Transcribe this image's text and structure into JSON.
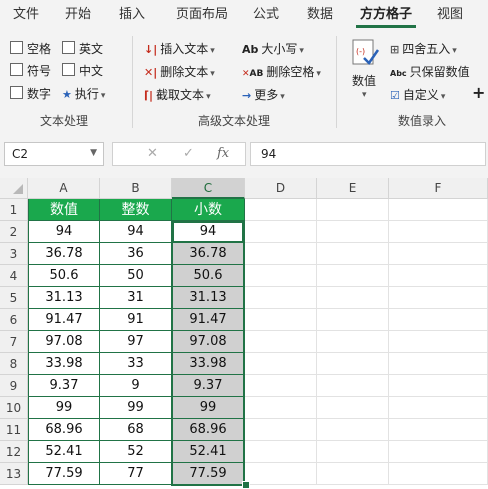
{
  "tabs": [
    "文件",
    "开始",
    "插入",
    "页面布局",
    "公式",
    "数据",
    "方方格子",
    "视图"
  ],
  "active_tab": "方方格子",
  "ribbon": {
    "text_checks": [
      "空格",
      "英文",
      "符号",
      "中文",
      "数字"
    ],
    "exec_label": "执行",
    "text_group_label": "文本处理",
    "adv_buttons": [
      "插入文本",
      "删除文本",
      "截取文本",
      "大小写",
      "删除空格",
      "更多"
    ],
    "adv_group_label": "高级文本处理",
    "numeric_button": "数值",
    "num_buttons": [
      "四舍五入",
      "只保留数值",
      "自定义"
    ],
    "num_group_label": "数值录入",
    "more_symbol": "+"
  },
  "namebox": "C2",
  "formula": "94",
  "columns": [
    "A",
    "B",
    "C",
    "D",
    "E",
    "F"
  ],
  "rows": [
    "1",
    "2",
    "3",
    "4",
    "5",
    "6",
    "7",
    "8",
    "9",
    "10",
    "11",
    "12",
    "13"
  ],
  "headers": [
    "数值",
    "整数",
    "小数"
  ],
  "table": [
    [
      "94",
      "94",
      "94"
    ],
    [
      "36.78",
      "36",
      "36.78"
    ],
    [
      "50.6",
      "50",
      "50.6"
    ],
    [
      "31.13",
      "31",
      "31.13"
    ],
    [
      "91.47",
      "91",
      "91.47"
    ],
    [
      "97.08",
      "97",
      "97.08"
    ],
    [
      "33.98",
      "33",
      "33.98"
    ],
    [
      "9.37",
      "9",
      "9.37"
    ],
    [
      "99",
      "99",
      "99"
    ],
    [
      "68.96",
      "68",
      "68.96"
    ],
    [
      "52.41",
      "52",
      "52.41"
    ],
    [
      "77.59",
      "77",
      "77.59"
    ]
  ],
  "colors": {
    "accent": "#217346",
    "header_fill": "#1aa84d",
    "selection": "#d0d0d0"
  }
}
